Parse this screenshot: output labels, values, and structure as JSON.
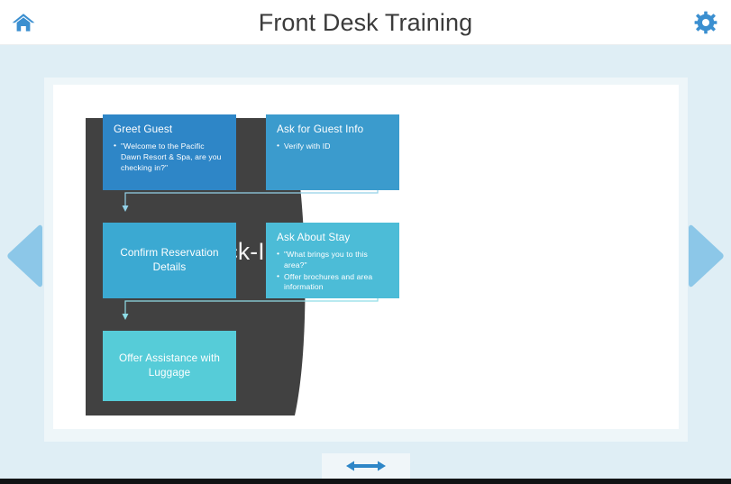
{
  "header": {
    "title": "Front Desk Training",
    "home_icon": "home-icon",
    "settings_icon": "gear-icon"
  },
  "slide": {
    "title_block": {
      "text": "Guest Check-In Procedures",
      "background_color": "#414141",
      "text_color": "#f2f2f2"
    },
    "flowchart": {
      "nodes": [
        {
          "id": "greet-guest",
          "title": "Greet Guest",
          "bullets": [
            "\"Welcome to the Pacific Dawn Resort & Spa, are you checking in?\""
          ],
          "color": "#2e86c7",
          "align": "left"
        },
        {
          "id": "ask-for-guest-info",
          "title": "Ask for Guest Info",
          "bullets": [
            "Verify with ID"
          ],
          "color": "#3b9bcd",
          "align": "left"
        },
        {
          "id": "confirm-reservation-details",
          "title": "Confirm Reservation Details",
          "bullets": [],
          "color": "#3ba9d2",
          "align": "center"
        },
        {
          "id": "ask-about-stay",
          "title": "Ask About Stay",
          "bullets": [
            "\"What brings you to this area?\"",
            "Offer brochures and area information"
          ],
          "color": "#4cbcd7",
          "align": "left"
        },
        {
          "id": "offer-assistance-with-luggage",
          "title": "Offer Assistance with Luggage",
          "bullets": [],
          "color": "#56ccd8",
          "align": "center"
        }
      ],
      "connectors": [
        {
          "from": "greet-guest",
          "to": "ask-for-guest-info",
          "color": "#63a8d8"
        },
        {
          "from": "ask-for-guest-info",
          "to": "confirm-reservation-details",
          "color": "#93d1e8"
        },
        {
          "from": "confirm-reservation-details",
          "to": "ask-about-stay",
          "color": "#7ecce0"
        },
        {
          "from": "ask-about-stay",
          "to": "offer-assistance-with-luggage",
          "color": "#8fdde6"
        }
      ]
    }
  },
  "navigation": {
    "previous_label": "Previous slide",
    "next_label": "Next slide",
    "arrow_color": "#8cc7e8"
  },
  "bottom": {
    "resize_handle": "resize-horizontal-icon",
    "handle_color": "#2e86c7"
  },
  "colors": {
    "page_background": "#dfeef5",
    "frame_background": "#eef6f9",
    "canvas_background": "#ffffff",
    "header_background": "#ffffff",
    "accent": "#3b8fd0"
  }
}
